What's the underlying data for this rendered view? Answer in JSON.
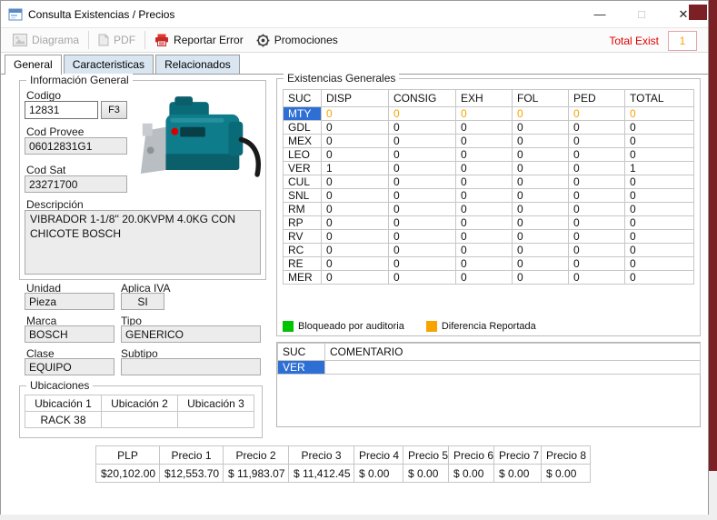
{
  "colors": {
    "accent_blue": "#2e6fd6",
    "orange": "#f7a400",
    "green": "#00c400",
    "red": "#e00000",
    "maroon": "#7b2125",
    "field_bg": "#ececec"
  },
  "window": {
    "title": "Consulta Existencias / Precios",
    "minimize_glyph": "—",
    "maximize_glyph": "□",
    "close_glyph": "✕"
  },
  "toolbar": {
    "diagrama": "Diagrama",
    "pdf": "PDF",
    "reportar_error": "Reportar Error",
    "promociones": "Promociones",
    "total_exist_label": "Total Exist",
    "total_exist_value": "1"
  },
  "tabs": [
    {
      "label": "General",
      "active": true
    },
    {
      "label": "Caracteristicas",
      "active": false
    },
    {
      "label": "Relacionados",
      "active": false
    }
  ],
  "info": {
    "group_title": "Información General",
    "codigo_label": "Codigo",
    "codigo_value": "12831",
    "f3_button": "F3",
    "cod_provee_label": "Cod Provee",
    "cod_provee_value": "06012831G1",
    "cod_sat_label": "Cod Sat",
    "cod_sat_value": "23271700",
    "descripcion_label": "Descripción",
    "descripcion_value": "VIBRADOR 1-1/8'' 20.0KVPM 4.0KG CON CHICOTE BOSCH",
    "unidad_label": "Unidad",
    "unidad_value": "Pieza",
    "aplica_iva_label": "Aplica IVA",
    "aplica_iva_value": "SI",
    "marca_label": "Marca",
    "marca_value": "BOSCH",
    "tipo_label": "Tipo",
    "tipo_value": "GENERICO",
    "clase_label": "Clase",
    "clase_value": "EQUIPO",
    "subtipo_label": "Subtipo",
    "subtipo_value": ""
  },
  "ubicaciones": {
    "group_title": "Ubicaciones",
    "headers": [
      "Ubicación 1",
      "Ubicación 2",
      "Ubicación 3"
    ],
    "values": [
      "RACK 38",
      "",
      ""
    ]
  },
  "existencias": {
    "group_title": "Existencias Generales",
    "headers": [
      "SUC",
      "DISP",
      "CONSIG",
      "EXH",
      "FOL",
      "PED",
      "TOTAL"
    ],
    "rows": [
      {
        "suc": "MTY",
        "values": [
          "0",
          "0",
          "0",
          "0",
          "0",
          "0"
        ],
        "selected": true,
        "orange": true
      },
      {
        "suc": "GDL",
        "values": [
          "0",
          "0",
          "0",
          "0",
          "0",
          "0"
        ]
      },
      {
        "suc": "MEX",
        "values": [
          "0",
          "0",
          "0",
          "0",
          "0",
          "0"
        ]
      },
      {
        "suc": "LEO",
        "values": [
          "0",
          "0",
          "0",
          "0",
          "0",
          "0"
        ]
      },
      {
        "suc": "VER",
        "values": [
          "1",
          "0",
          "0",
          "0",
          "0",
          "1"
        ]
      },
      {
        "suc": "CUL",
        "values": [
          "0",
          "0",
          "0",
          "0",
          "0",
          "0"
        ]
      },
      {
        "suc": "SNL",
        "values": [
          "0",
          "0",
          "0",
          "0",
          "0",
          "0"
        ]
      },
      {
        "suc": "RM",
        "values": [
          "0",
          "0",
          "0",
          "0",
          "0",
          "0"
        ]
      },
      {
        "suc": "RP",
        "values": [
          "0",
          "0",
          "0",
          "0",
          "0",
          "0"
        ]
      },
      {
        "suc": "RV",
        "values": [
          "0",
          "0",
          "0",
          "0",
          "0",
          "0"
        ]
      },
      {
        "suc": "RC",
        "values": [
          "0",
          "0",
          "0",
          "0",
          "0",
          "0"
        ]
      },
      {
        "suc": "RE",
        "values": [
          "0",
          "0",
          "0",
          "0",
          "0",
          "0"
        ]
      },
      {
        "suc": "MER",
        "values": [
          "0",
          "0",
          "0",
          "0",
          "0",
          "0"
        ]
      }
    ],
    "legend": [
      {
        "color": "#00c400",
        "label": "Bloqueado por auditoria"
      },
      {
        "color": "#f7a400",
        "label": "Diferencia Reportada"
      }
    ]
  },
  "comentarios": {
    "headers": [
      "SUC",
      "COMENTARIO"
    ],
    "rows": [
      {
        "suc": "VER",
        "comentario": "",
        "selected": true
      }
    ]
  },
  "precios": {
    "headers": [
      "PLP",
      "Precio 1",
      "Precio 2",
      "Precio 3",
      "Precio 4",
      "Precio 5",
      "Precio 6",
      "Precio 7",
      "Precio 8"
    ],
    "values": [
      "$20,102.00",
      "$12,553.70",
      "$ 11,983.07",
      "$ 11,412.45",
      "$ 0.00",
      "$ 0.00",
      "$ 0.00",
      "$ 0.00",
      "$ 0.00"
    ]
  }
}
